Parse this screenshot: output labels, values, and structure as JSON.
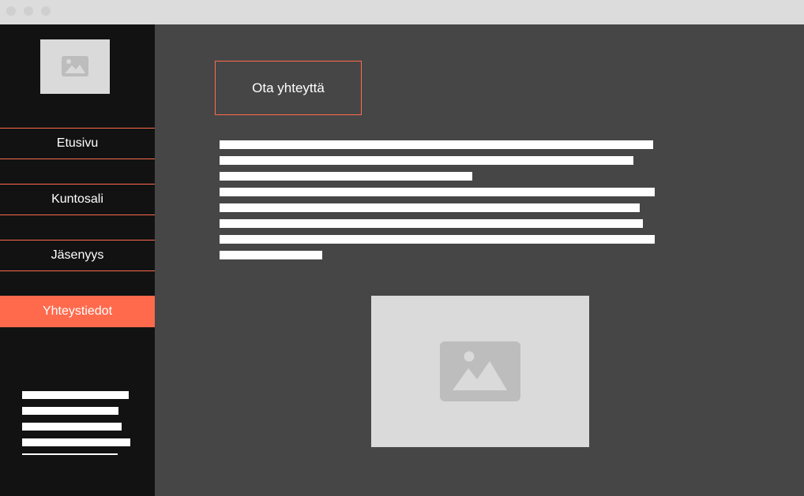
{
  "window": {
    "controls": [
      "close-dot",
      "minimize-dot",
      "maximize-dot"
    ]
  },
  "sidebar": {
    "logo_icon": "image-placeholder-icon",
    "items": [
      {
        "label": "Etusivu",
        "active": false
      },
      {
        "label": "Kuntosali",
        "active": false
      },
      {
        "label": "Jäsenyys",
        "active": false
      },
      {
        "label": "Yhteystiedot",
        "active": true
      }
    ]
  },
  "main": {
    "heading": "Ota yhteyttä",
    "image_icon": "image-placeholder-icon"
  },
  "colors": {
    "accent": "#ff6a4d",
    "sidebar_bg": "#121212",
    "main_bg": "#464646",
    "placeholder_bg": "#dadada",
    "placeholder_icon": "#bdbdbd",
    "titlebar": "#dcdcdc"
  }
}
